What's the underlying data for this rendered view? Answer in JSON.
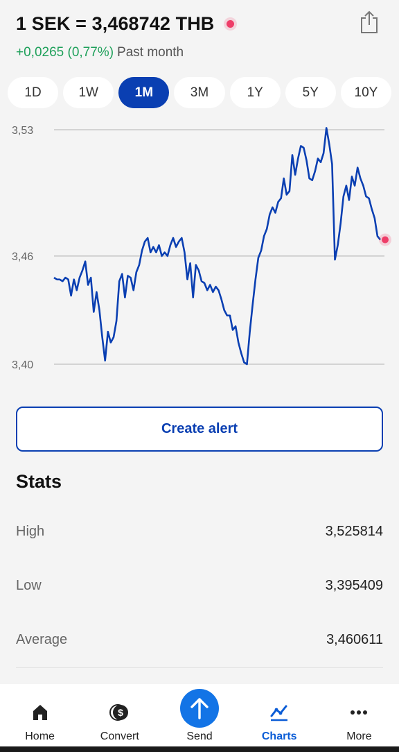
{
  "header": {
    "title": "1 SEK = 3,468742 THB",
    "change": "+0,0265 (0,77%)",
    "period": "Past month"
  },
  "ranges": {
    "items": [
      "1D",
      "1W",
      "1M",
      "3M",
      "1Y",
      "5Y",
      "10Y"
    ],
    "selected": "1M"
  },
  "chart_data": {
    "type": "line",
    "title": "",
    "xlabel": "",
    "ylabel": "",
    "ylim": [
      3.4,
      3.53
    ],
    "yticks": [
      "3,53",
      "3,46",
      "3,40"
    ],
    "ytick_values": [
      3.53,
      3.46,
      3.4
    ],
    "grid": true,
    "line_color": "#0a3fb2",
    "marker_color": "#ee3d68",
    "series": [
      {
        "values": [
          3.448,
          3.447,
          3.447,
          3.446,
          3.448,
          3.447,
          3.438,
          3.447,
          3.441,
          3.448,
          3.452,
          3.457,
          3.444,
          3.448,
          3.429,
          3.44,
          3.43,
          3.415,
          3.402,
          3.418,
          3.412,
          3.415,
          3.424,
          3.446,
          3.45,
          3.437,
          3.449,
          3.448,
          3.441,
          3.451,
          3.455,
          3.463,
          3.468,
          3.47,
          3.462,
          3.465,
          3.462,
          3.466,
          3.46,
          3.462,
          3.46,
          3.466,
          3.47,
          3.465,
          3.468,
          3.47,
          3.462,
          3.447,
          3.456,
          3.437,
          3.455,
          3.452,
          3.446,
          3.445,
          3.441,
          3.444,
          3.44,
          3.443,
          3.441,
          3.436,
          3.43,
          3.427,
          3.427,
          3.419,
          3.421,
          3.412,
          3.406,
          3.401,
          3.4,
          3.418,
          3.433,
          3.447,
          3.459,
          3.463,
          3.471,
          3.475,
          3.483,
          3.487,
          3.484,
          3.49,
          3.492,
          3.503,
          3.494,
          3.496,
          3.516,
          3.505,
          3.514,
          3.521,
          3.52,
          3.513,
          3.503,
          3.502,
          3.507,
          3.514,
          3.512,
          3.517,
          3.531,
          3.522,
          3.511,
          3.458,
          3.466,
          3.478,
          3.493,
          3.499,
          3.491,
          3.504,
          3.499,
          3.509,
          3.503,
          3.499,
          3.493,
          3.492,
          3.486,
          3.481,
          3.471,
          3.469
        ]
      }
    ]
  },
  "alert": {
    "label": "Create alert"
  },
  "stats": {
    "title": "Stats",
    "rows": [
      {
        "label": "High",
        "value": "3,525814"
      },
      {
        "label": "Low",
        "value": "3,395409"
      },
      {
        "label": "Average",
        "value": "3,460611"
      }
    ]
  },
  "nav": {
    "items": [
      {
        "label": "Home",
        "icon": "home-icon"
      },
      {
        "label": "Convert",
        "icon": "convert-icon"
      },
      {
        "label": "Send",
        "icon": "send-icon"
      },
      {
        "label": "Charts",
        "icon": "charts-icon"
      },
      {
        "label": "More",
        "icon": "more-icon"
      }
    ],
    "active": "Charts"
  }
}
